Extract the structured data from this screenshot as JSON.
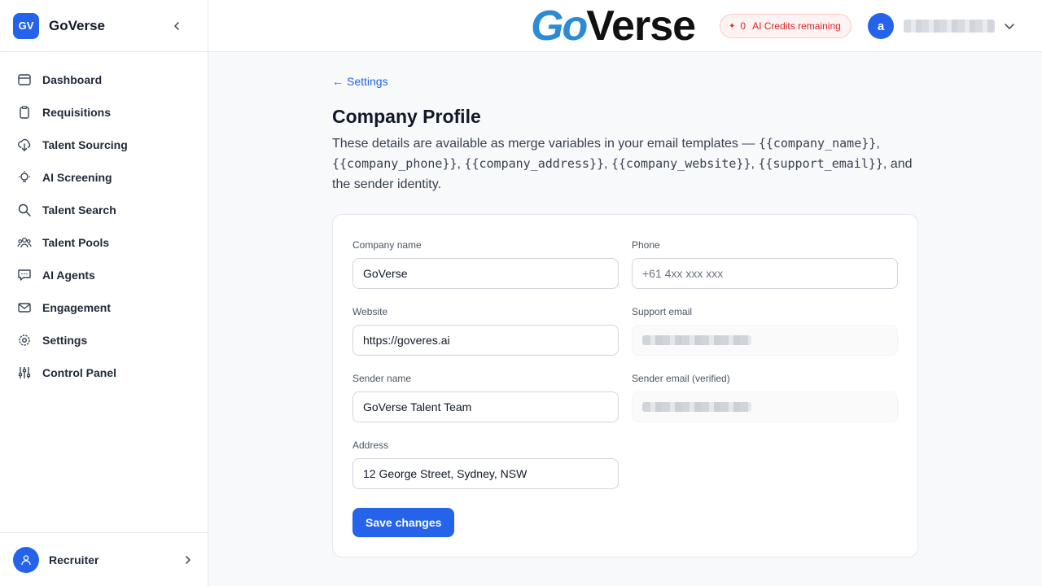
{
  "sidebar": {
    "logo_text": "GV",
    "app_name": "GoVerse",
    "items": [
      {
        "label": "Dashboard",
        "icon": "calendar-icon"
      },
      {
        "label": "Requisitions",
        "icon": "clipboard-icon"
      },
      {
        "label": "Talent Sourcing",
        "icon": "cloud-download-icon"
      },
      {
        "label": "AI Screening",
        "icon": "lightbulb-icon"
      },
      {
        "label": "Talent Search",
        "icon": "search-icon"
      },
      {
        "label": "Talent Pools",
        "icon": "users-icon"
      },
      {
        "label": "AI Agents",
        "icon": "chat-icon"
      },
      {
        "label": "Engagement",
        "icon": "mail-icon"
      },
      {
        "label": "Settings",
        "icon": "gear-icon"
      },
      {
        "label": "Control Panel",
        "icon": "sliders-icon"
      }
    ],
    "footer_role": "Recruiter"
  },
  "topbar": {
    "brand_go": "Go",
    "brand_verse": "Verse",
    "credits_count": "0",
    "credits_label": "AI Credits remaining",
    "avatar_letter": "a"
  },
  "main": {
    "back_label": "Settings",
    "title": "Company Profile",
    "desc_intro": "These details are available as merge variables in your email templates — ",
    "vars": [
      "{{company_name}}",
      "{{company_phone}}",
      "{{company_address}}",
      "{{company_website}}",
      "{{support_email}}"
    ],
    "desc_outro": ", and the sender identity."
  },
  "form": {
    "company_name": {
      "label": "Company name",
      "value": "GoVerse"
    },
    "phone": {
      "label": "Phone",
      "placeholder": "+61 4xx xxx xxx"
    },
    "website": {
      "label": "Website",
      "value": "https://goveres.ai"
    },
    "support_email": {
      "label": "Support email"
    },
    "sender_name": {
      "label": "Sender name",
      "value": "GoVerse Talent Team"
    },
    "sender_email": {
      "label": "Sender email (verified)"
    },
    "address": {
      "label": "Address",
      "value": "12 George Street, Sydney, NSW"
    },
    "save_label": "Save changes"
  },
  "colors": {
    "accent": "#2563eb",
    "credits_red": "#dc2626",
    "logo_blue": "#2b8bd6"
  }
}
